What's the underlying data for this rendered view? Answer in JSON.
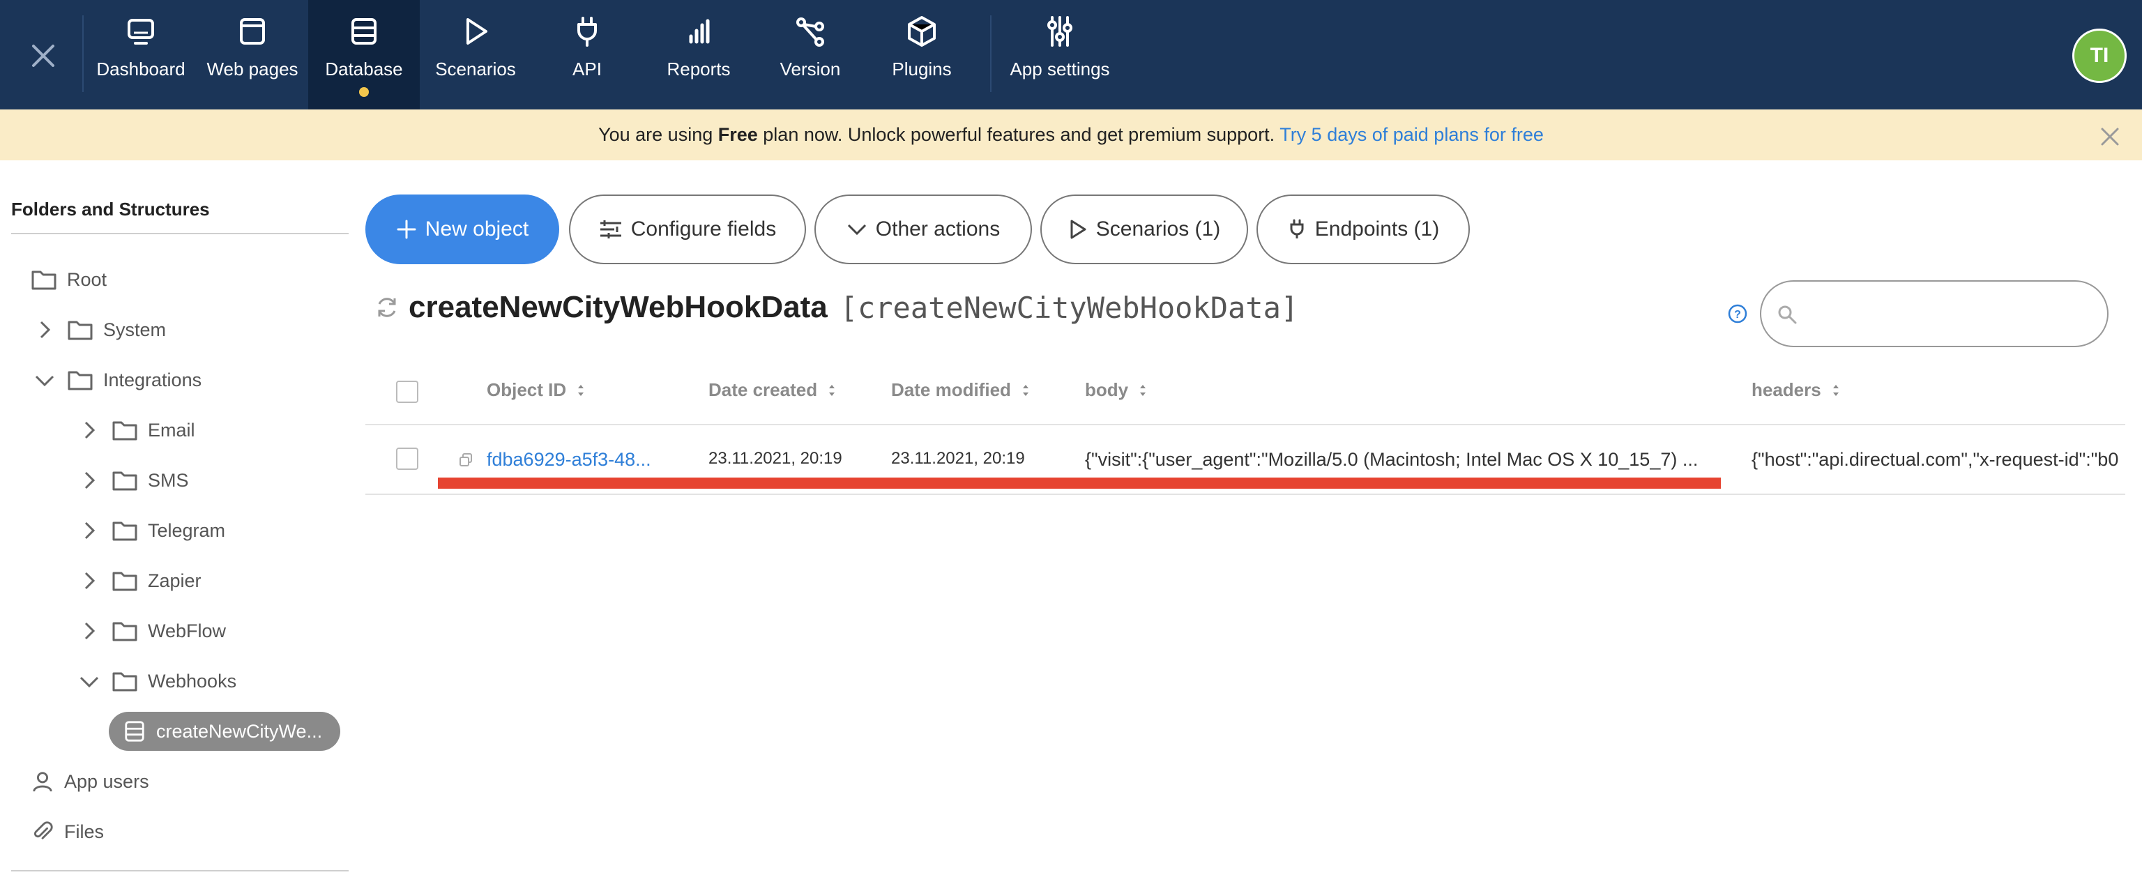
{
  "nav": {
    "items": [
      {
        "label": "Dashboard",
        "icon": "monitor-icon"
      },
      {
        "label": "Web pages",
        "icon": "browser-window-icon"
      },
      {
        "label": "Database",
        "icon": "database-icon",
        "active": true
      },
      {
        "label": "Scenarios",
        "icon": "play-icon"
      },
      {
        "label": "API",
        "icon": "plug-icon"
      },
      {
        "label": "Reports",
        "icon": "bar-chart-icon"
      },
      {
        "label": "Version",
        "icon": "branch-icon"
      },
      {
        "label": "Plugins",
        "icon": "cube-icon"
      },
      {
        "label": "App settings",
        "icon": "sliders-icon"
      }
    ],
    "avatar": "TI"
  },
  "banner": {
    "prefix": "You are using ",
    "plan": "Free",
    "suffix": " plan now. Unlock powerful features and get premium support. ",
    "link": "Try 5 days of paid plans for free"
  },
  "sidebar": {
    "title": "Folders and Structures",
    "tree": [
      {
        "label": "Root"
      },
      {
        "label": "System"
      },
      {
        "label": "Integrations"
      },
      {
        "label": "Email"
      },
      {
        "label": "SMS"
      },
      {
        "label": "Telegram"
      },
      {
        "label": "Zapier"
      },
      {
        "label": "WebFlow"
      },
      {
        "label": "Webhooks"
      },
      {
        "label": "createNewCityWe..."
      },
      {
        "label": "App users"
      },
      {
        "label": "Files"
      }
    ]
  },
  "toolbar": {
    "new_object": "New object",
    "configure_fields": "Configure fields",
    "other_actions": "Other actions",
    "scenarios": "Scenarios (1)",
    "endpoints": "Endpoints (1)"
  },
  "structure": {
    "name": "createNewCityWebHookData",
    "sysname": "[createNewCityWebHookData]"
  },
  "search": {
    "placeholder": ""
  },
  "table": {
    "columns": [
      "Object ID",
      "Date created",
      "Date modified",
      "body",
      "headers"
    ],
    "rows": [
      {
        "id": "fdba6929-a5f3-48...",
        "created": "23.11.2021, 20:19",
        "modified": "23.11.2021, 20:19",
        "body": "{\"visit\":{\"user_agent\":\"Mozilla/5.0 (Macintosh; Intel Mac OS X 10_15_7) ...",
        "headers": "{\"host\":\"api.directual.com\",\"x-request-id\":\"b0"
      }
    ]
  },
  "colors": {
    "nav_bg": "#1b3558",
    "nav_active_bg": "#0f2440",
    "banner_bg": "#faecc7",
    "primary": "#3b87e6",
    "link": "#2f7fd8",
    "avatar": "#74b843",
    "highlight_red": "#e64431",
    "active_dot": "#f3c64d"
  }
}
